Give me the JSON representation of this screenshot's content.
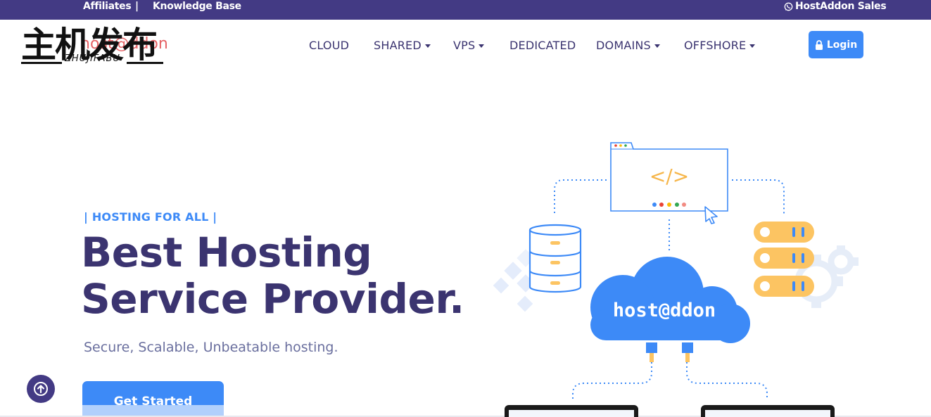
{
  "topbar": {
    "affiliates": "Affiliates",
    "separator": "|",
    "knowledge_base": "Knowledge Base",
    "sales": "HostAddon Sales"
  },
  "watermark": {
    "chinese": "主机发布",
    "pinyin": "ZHUJIFABU",
    "brand_partial": "host@ddon"
  },
  "nav": {
    "items": [
      {
        "label": "CLOUD",
        "dropdown": false
      },
      {
        "label": "SHARED",
        "dropdown": true
      },
      {
        "label": "VPS",
        "dropdown": true
      },
      {
        "label": "DEDICATED",
        "dropdown": false
      },
      {
        "label": "DOMAINS",
        "dropdown": true
      },
      {
        "label": "OFFSHORE",
        "dropdown": true
      }
    ],
    "login": "Login"
  },
  "hero": {
    "tagline": "| HOSTING FOR ALL |",
    "title_line1": "Best Hosting",
    "title_line2": "Service Provider.",
    "subtitle": "Secure, Scalable, Unbeatable hosting.",
    "cta": "Get Started"
  },
  "illustration": {
    "cloud_label": "host@ddon",
    "code_symbol": "</>",
    "icons": [
      "browser-window-icon",
      "database-icon",
      "server-rack-icon",
      "gear-icon",
      "cloud-icon",
      "cursor-icon",
      "laptop-icon"
    ]
  },
  "colors": {
    "brand_purple": "#433a84",
    "heading": "#3b3470",
    "accent_blue": "#3d8af7",
    "server_yellow": "#fcc462",
    "code_orange": "#f6b64a"
  }
}
